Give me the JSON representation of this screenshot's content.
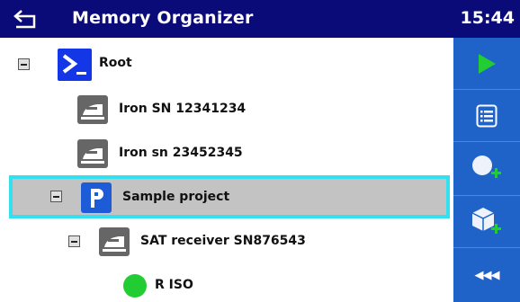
{
  "header": {
    "title": "Memory Organizer",
    "time": "15:44",
    "back_icon": "back-arrow-icon",
    "background": "#0a0a78"
  },
  "toolbar": {
    "background": "#1f63c9",
    "buttons": [
      {
        "icon": "play-icon",
        "color": "#22cc33"
      },
      {
        "icon": "list-icon"
      },
      {
        "icon": "add-measurement-icon"
      },
      {
        "icon": "add-structure-icon"
      }
    ],
    "more_label": "◀◀◀"
  },
  "tree": {
    "root": {
      "label": "Root",
      "icon": "terminal-icon"
    },
    "items": [
      {
        "label": "Iron SN 12341234",
        "icon": "iron-icon"
      },
      {
        "label": "Iron sn 23452345",
        "icon": "iron-icon"
      },
      {
        "label": "Sample project",
        "icon": "project-icon",
        "selected": true
      },
      {
        "label": "SAT receiver SN876543",
        "icon": "iron-icon"
      },
      {
        "label": "R ISO",
        "icon": "status-dot-icon",
        "status_color": "#22cc33"
      }
    ],
    "selection_border": "#33e0f0"
  }
}
